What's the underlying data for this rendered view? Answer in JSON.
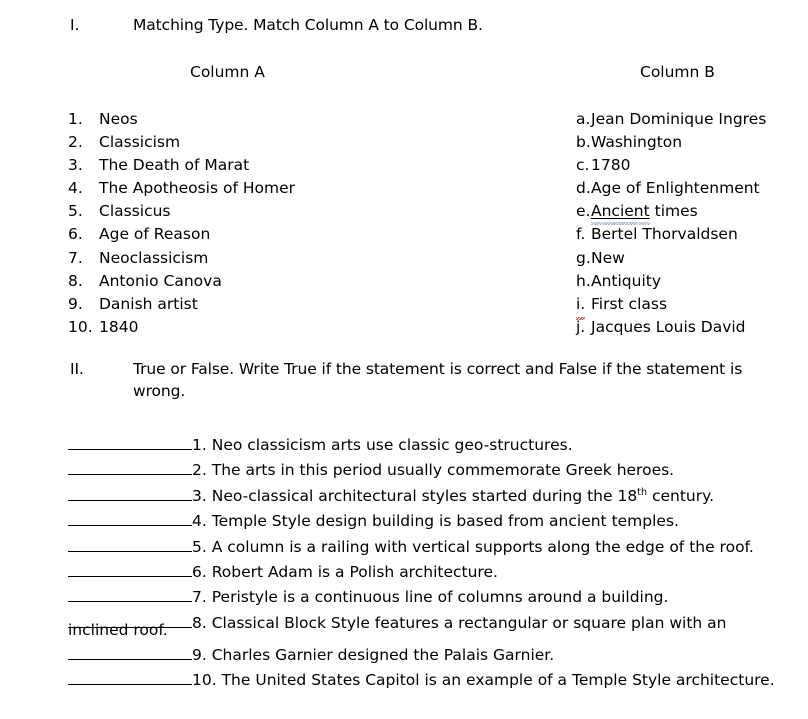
{
  "document": {
    "sections": [
      {
        "numeral": "I.",
        "instruction": "Matching Type. Match Column A to Column B."
      },
      {
        "numeral": "II.",
        "instruction": "True or False. Write True if the statement is correct and False if the statement is wrong."
      }
    ]
  },
  "matching": {
    "column_a_header": "Column A",
    "column_b_header": "Column B",
    "column_a": [
      {
        "marker": "1.",
        "text": "Neos"
      },
      {
        "marker": "2.",
        "text": "Classicism"
      },
      {
        "marker": "3.",
        "text": "The Death of Marat"
      },
      {
        "marker": "4.",
        "text": "The Apotheosis of Homer"
      },
      {
        "marker": "5.",
        "text": "Classicus"
      },
      {
        "marker": "6.",
        "text": "Age of Reason"
      },
      {
        "marker": "7.",
        "text": "Neoclassicism"
      },
      {
        "marker": "8.",
        "text": "Antonio Canova"
      },
      {
        "marker": "9.",
        "text": "Danish artist"
      },
      {
        "marker": "10.",
        "text": "1840"
      }
    ],
    "column_b": [
      {
        "marker": "a.",
        "text": "Jean Dominique Ingres"
      },
      {
        "marker": "b.",
        "text": "Washington"
      },
      {
        "marker": "c.",
        "text": "1780"
      },
      {
        "marker": "d.",
        "text": "Age of Enlightenment"
      },
      {
        "marker": "e.",
        "text": "Ancient times",
        "underlined_word": "Ancient",
        "rest": " times"
      },
      {
        "marker": "f.",
        "text": "Bertel Thorvaldsen"
      },
      {
        "marker": "g.",
        "text": "New"
      },
      {
        "marker": "h.",
        "text": "Antiquity"
      },
      {
        "marker": "i.",
        "text": "First class"
      },
      {
        "marker": "j.",
        "text": "Jacques Louis David"
      }
    ]
  },
  "true_false": {
    "items": [
      {
        "number": "1.",
        "text": "Neo classicism arts use classic geo-structures."
      },
      {
        "number": "2.",
        "text": "The arts in this period usually commemorate Greek heroes."
      },
      {
        "number": "3.",
        "text": "Neo-classical architectural styles started during the 18",
        "sup": "th",
        "text_after": " century."
      },
      {
        "number": "4.",
        "text": "Temple Style design building is based from ancient temples."
      },
      {
        "number": "5.",
        "text": "A column is a railing with vertical supports along the edge of the roof."
      },
      {
        "number": "6.",
        "text": "Robert Adam is a Polish architecture."
      },
      {
        "number": "7.",
        "text": "Peristyle is a continuous line of columns around a building."
      },
      {
        "number": "8.",
        "text": "Classical Block Style features a rectangular or square plan with an"
      },
      {
        "number": "9.",
        "text": "Charles Garnier designed the Palais Garnier."
      },
      {
        "number": "10.",
        "text": "The United States Capitol is an example of a Temple Style architecture."
      }
    ],
    "item_8_continuation": "inclined roof."
  },
  "colors": {
    "text": "#000000",
    "page_background": "#ffffff",
    "spellcheck_red": "#c0392b",
    "grammarcheck_blue": "#7d96ae"
  }
}
